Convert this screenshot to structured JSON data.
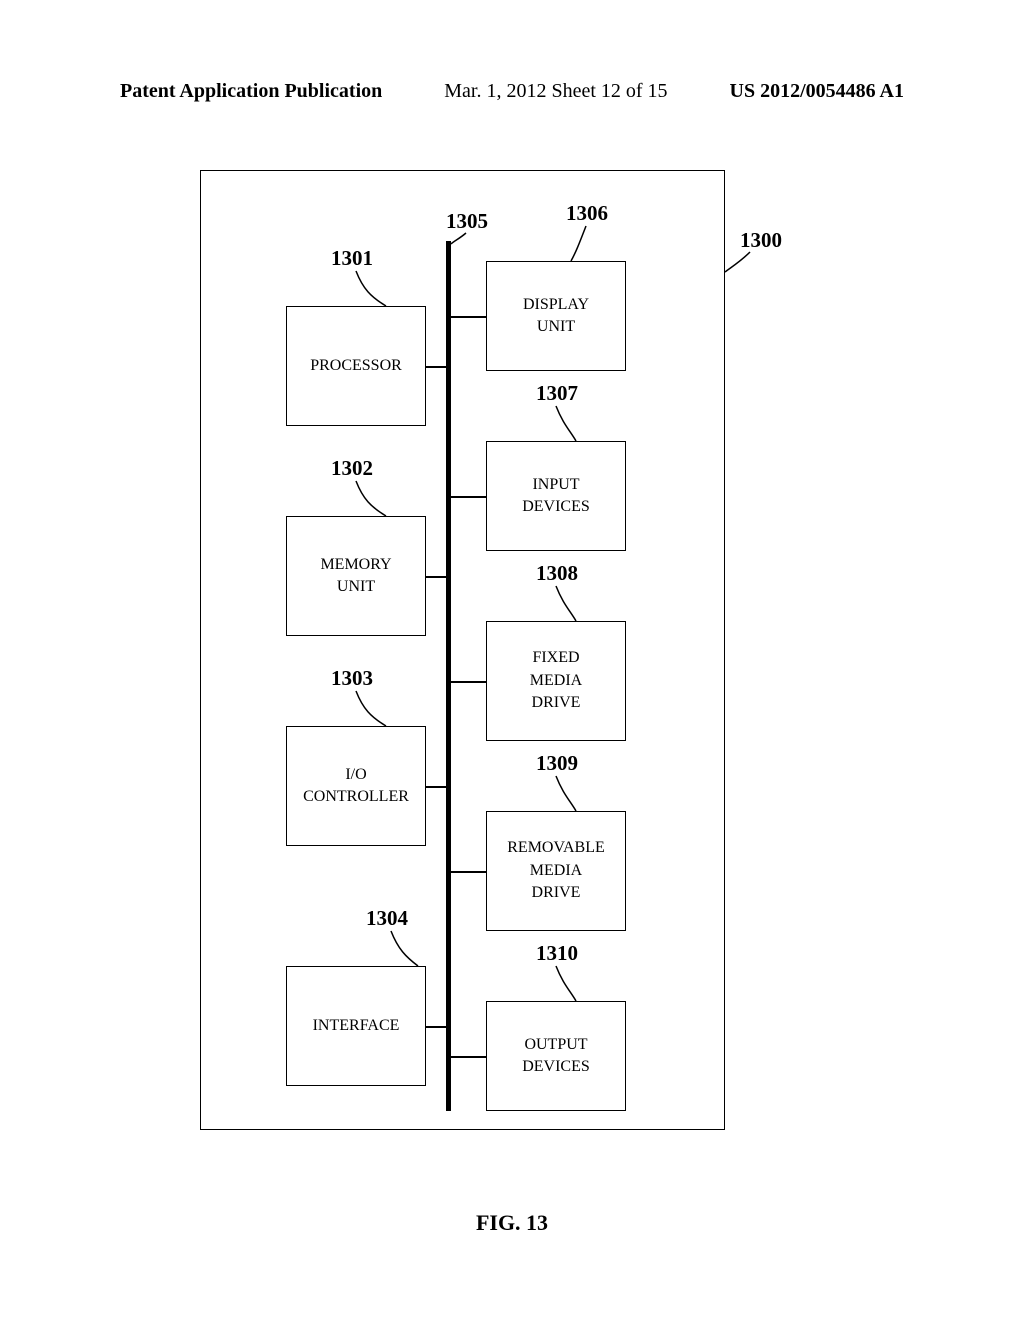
{
  "header": {
    "left": "Patent Application Publication",
    "center": "Mar. 1, 2012  Sheet 12 of 15",
    "right": "US 2012/0054486 A1"
  },
  "refs": {
    "r1300": "1300",
    "r1301": "1301",
    "r1302": "1302",
    "r1303": "1303",
    "r1304": "1304",
    "r1305": "1305",
    "r1306": "1306",
    "r1307": "1307",
    "r1308": "1308",
    "r1309": "1309",
    "r1310": "1310"
  },
  "boxes": {
    "processor": "PROCESSOR",
    "memory_l1": "MEMORY",
    "memory_l2": "UNIT",
    "io_l1": "I/O",
    "io_l2": "CONTROLLER",
    "interface": "INTERFACE",
    "display_l1": "DISPLAY",
    "display_l2": "UNIT",
    "input_l1": "INPUT",
    "input_l2": "DEVICES",
    "fixed_l1": "FIXED",
    "fixed_l2": "MEDIA",
    "fixed_l3": "DRIVE",
    "removable_l1": "REMOVABLE",
    "removable_l2": "MEDIA",
    "removable_l3": "DRIVE",
    "output_l1": "OUTPUT",
    "output_l2": "DEVICES"
  },
  "caption": "FIG. 13"
}
